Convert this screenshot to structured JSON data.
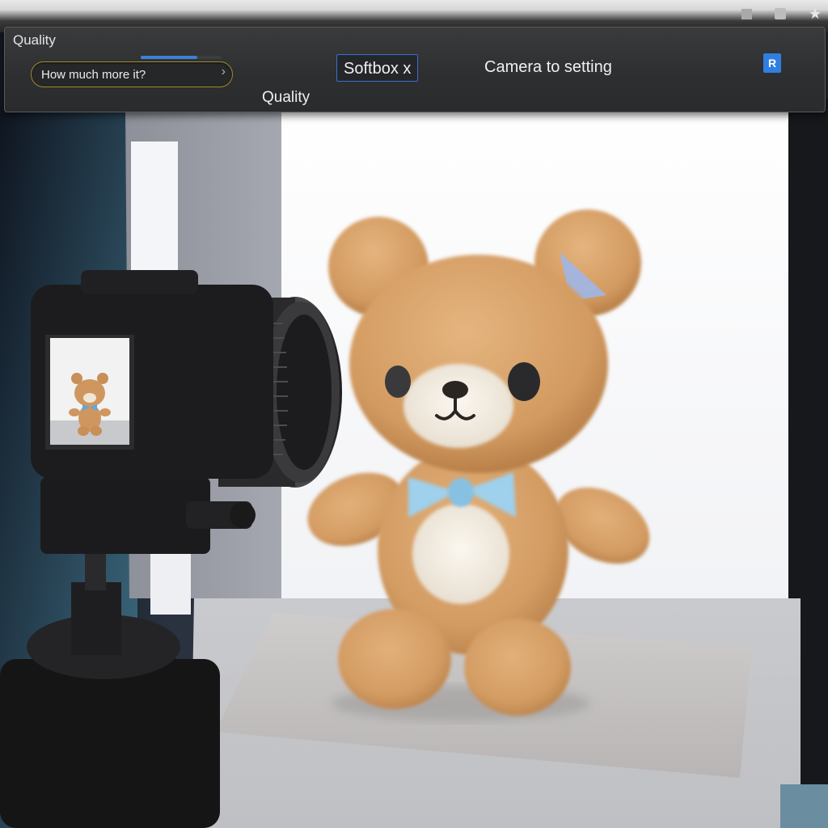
{
  "window": {
    "title": "Quality"
  },
  "toolbar": {
    "search": {
      "value": "How much more it?",
      "progress": 0.7
    },
    "quality_label": "Quality",
    "softbox_label": "Softbox x",
    "camera_label": "Camera to setting",
    "badge_label": "R"
  },
  "icons": {
    "window_minimize": "square-icon",
    "window_maximize": "square-icon",
    "window_star": "star-icon",
    "search_chevron": "chevron-right-icon"
  },
  "colors": {
    "accent_blue": "#3f7fd8",
    "search_border": "#a38a2c",
    "bear_fur": "#d9a268",
    "bow": "#9fd0ec"
  }
}
